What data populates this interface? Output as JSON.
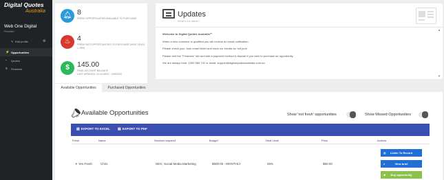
{
  "brand": {
    "line1": "Digital Quotes",
    "line2": "Australia"
  },
  "user": {
    "name": "Web One Digital",
    "role": "Provider",
    "edit_label": "Edit profile"
  },
  "nav": [
    {
      "label": "Opportunities",
      "icon": "lightning-icon"
    },
    {
      "label": "Quotes",
      "icon": "briefcase-icon"
    },
    {
      "label": "Finances",
      "icon": "dollar-icon"
    }
  ],
  "stats": [
    {
      "value": "8",
      "label": "FRESH OPPORTUNITIES AVAILABLE TO PURCHASE",
      "icon": "bell-icon",
      "color": "#2b9bd8"
    },
    {
      "value": "4",
      "label": "FRESH NOT OPPORTUNITIES TO PURCHASE (HEAT LEVEL < 75%)",
      "icon": "fire-icon",
      "color": "#d63a2f"
    },
    {
      "value": "145.00",
      "label": "FINAL ACCOUNT BALANCE",
      "label2": "LAST UPDATED: 21:44 AEST - 29/8/2022",
      "icon": "dollar-icon",
      "color": "#2eb85c"
    }
  ],
  "updates": {
    "title": "Updates",
    "subtitle": "What's the latest?",
    "lines": [
      "Welcome to Digital Quotes Australia™",
      "When a new customer is qualified you will recieve an email notification.",
      "Please check your Junk email folder and mark our emails as 'not junk'.",
      "Please visit the \"Finances\" tab and add a payment method & deposit if you wish to purchase an opportunity.",
      "We are always here: 1300 580 732 or email: support@digitalquotesaustralia.com.au"
    ]
  },
  "tabs": [
    "Available Opportunities",
    "Purchased Opportunities"
  ],
  "main": {
    "title": "Available Opportunities",
    "toggle_not_fresh": "Show 'not fresh' opportunities",
    "toggle_missed": "Show Missed Opportunities",
    "export_excel": "EXPORT TO EXCEL",
    "export_pdf": "EXPORT TO PDF",
    "accent": "#3a4fb0"
  },
  "table": {
    "headers": [
      "Fresh",
      "Name",
      "Services required",
      "Budget",
      "Heat Level",
      "Price",
      "Actions"
    ],
    "rows": [
      {
        "fresh": "Yes Fresh",
        "name": "Chris",
        "services": "SEO, Social Media Marketing",
        "budget": "$500.00 - MONTHLY",
        "heat": "45%",
        "price": "$50.00"
      }
    ],
    "actions": {
      "listen": "Listen To Record",
      "view": "View brief",
      "buy": "Buy opportunity"
    }
  }
}
